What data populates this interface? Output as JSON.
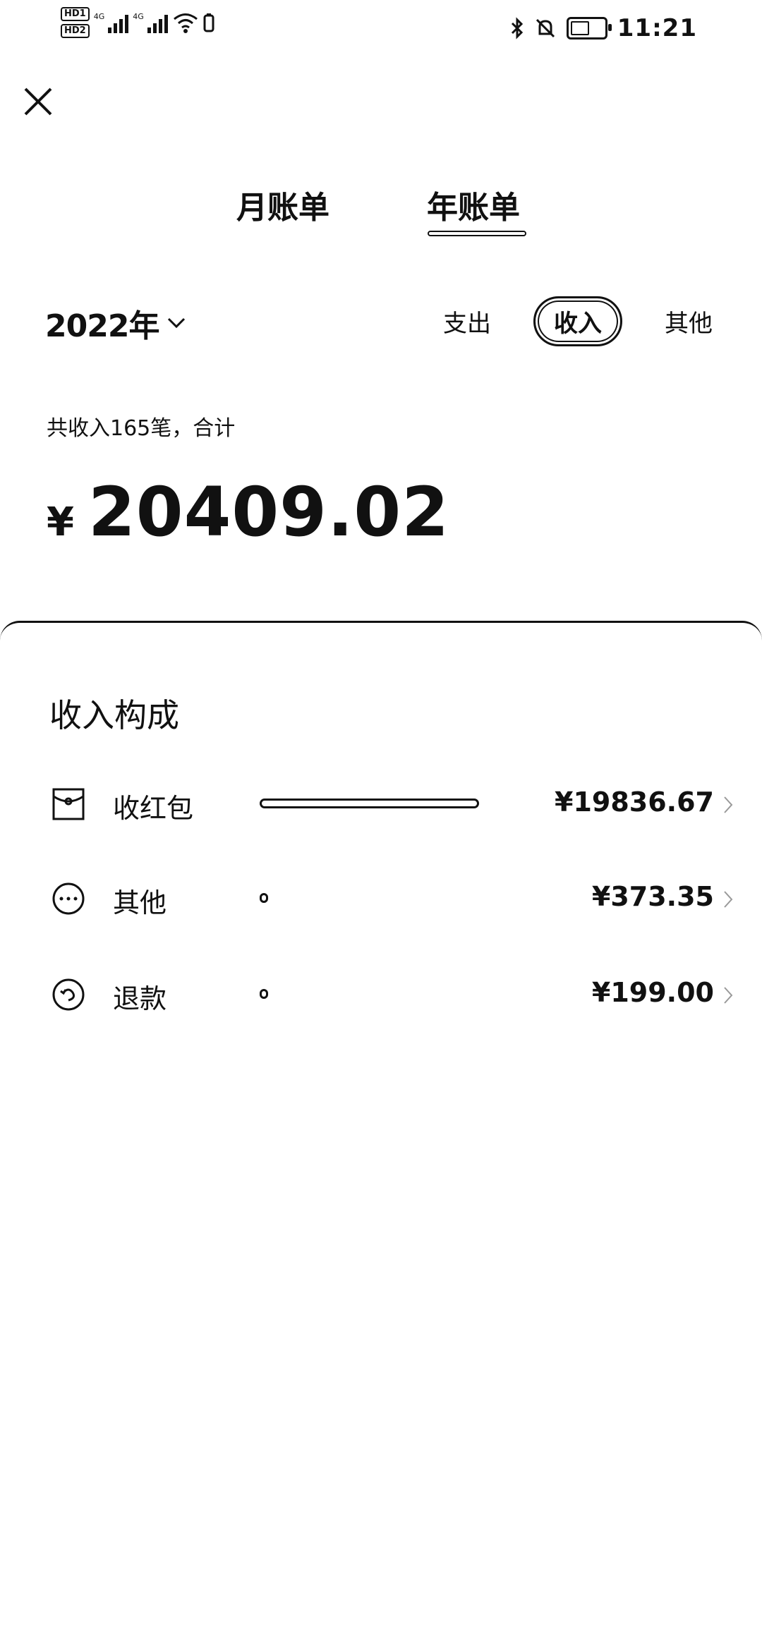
{
  "status_bar": {
    "hd1": "HD1",
    "hd2": "HD2",
    "net1": "4G",
    "net2": "4G",
    "time": "11:21"
  },
  "tabs": {
    "month": "月账单",
    "year": "年账单"
  },
  "year_selector": {
    "label": "2022年"
  },
  "filters": {
    "expense": "支出",
    "income": "收入",
    "other": "其他",
    "active": "income"
  },
  "summary": {
    "text": "共收入165笔，合计",
    "currency": "¥",
    "amount": "20409.02"
  },
  "composition": {
    "title": "收入构成",
    "items": [
      {
        "label": "收红包",
        "amount": "¥19836.67",
        "share": 0.972,
        "icon": "red-envelope-icon"
      },
      {
        "label": "其他",
        "amount": "¥373.35",
        "share": 0.018,
        "icon": "more-dots-icon"
      },
      {
        "label": "退款",
        "amount": "¥199.00",
        "share": 0.01,
        "icon": "refund-icon"
      }
    ]
  },
  "colors": {
    "text": "#111111",
    "background": "#ffffff"
  }
}
